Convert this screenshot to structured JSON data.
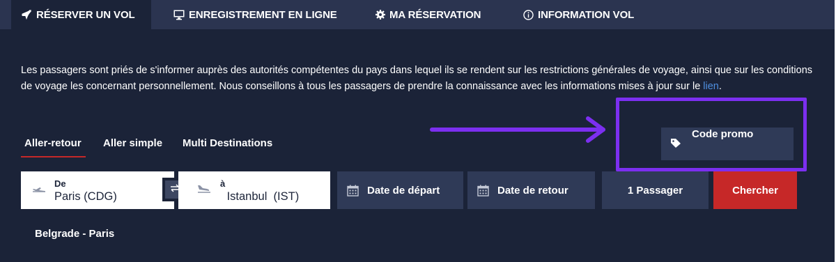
{
  "tabs": [
    {
      "label": "RÉSERVER UN VOL",
      "icon": "plane-icon",
      "active": true
    },
    {
      "label": "ENREGISTREMENT EN LIGNE",
      "icon": "monitor-icon",
      "active": false
    },
    {
      "label": "MA RÉSERVATION",
      "icon": "gear-icon",
      "active": false
    },
    {
      "label": "INFORMATION VOL",
      "icon": "info-icon",
      "active": false
    }
  ],
  "notice": {
    "text": "Les passagers sont priés de s'informer auprès des autorités compétentes du pays dans lequel ils se rendent sur les restrictions générales de voyage, ainsi que sur les conditions de voyage les concernant personnellement. Nous conseillons à tous les passagers de prendre la connaissance avec les informations mises à jour sur le",
    "link": "lien",
    "end": "."
  },
  "trip_types": [
    {
      "label": "Aller-retour",
      "selected": true
    },
    {
      "label": "Aller simple",
      "selected": false
    },
    {
      "label": "Multi Destinations",
      "selected": false
    }
  ],
  "promo": {
    "label": "Code promo",
    "icon": "tag-icon"
  },
  "search": {
    "from_label": "De",
    "from_value": "Paris (CDG)",
    "to_label": "à",
    "to_value": " Istanbul  (IST)",
    "departure": "Date de départ",
    "return": "Date de retour",
    "passengers": "1 Passager",
    "submit": "Chercher"
  },
  "recent_search": "Belgrade - Paris",
  "colors": {
    "background": "#1b2338",
    "tab_bar": "#2b3450",
    "field_dark": "#2f3a57",
    "accent_red": "#c62828",
    "link": "#4f8fe0",
    "annotation": "#7c2ff0"
  }
}
